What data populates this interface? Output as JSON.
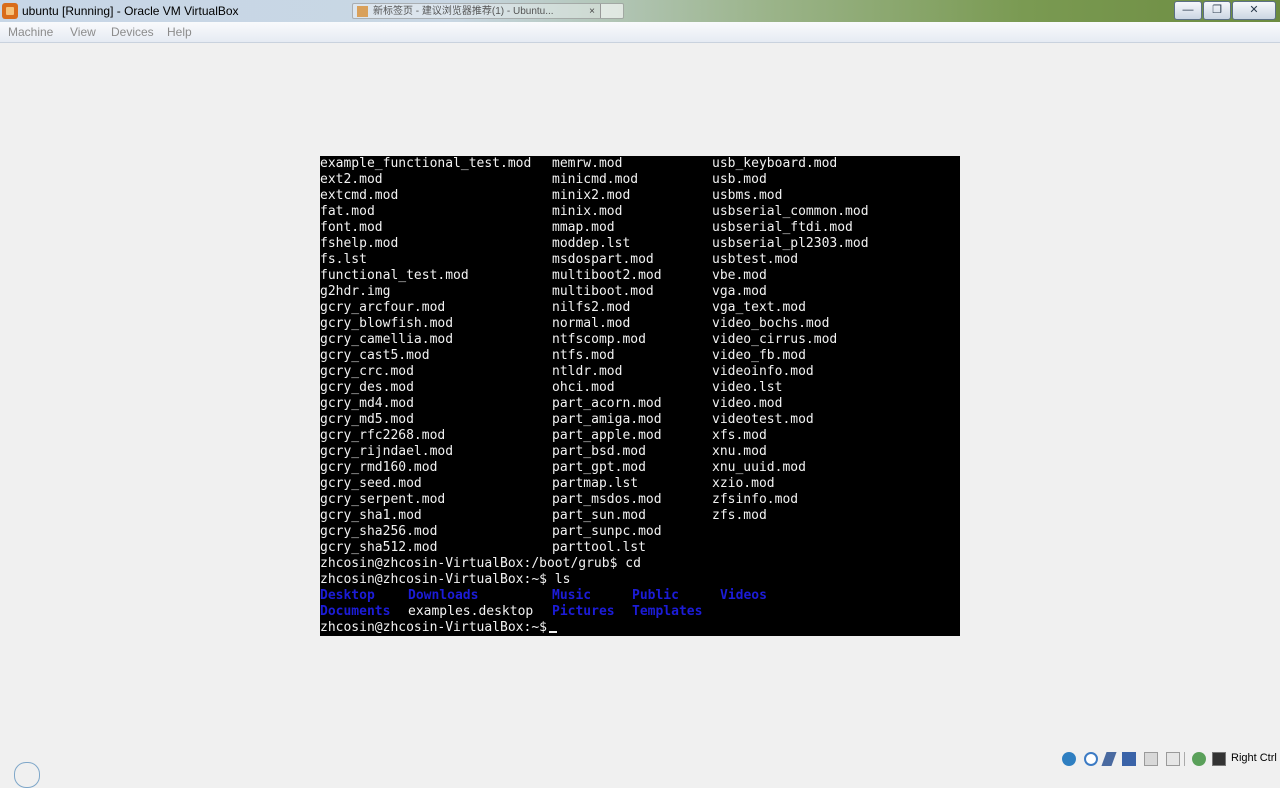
{
  "window": {
    "title": "ubuntu [Running] - Oracle VM VirtualBox",
    "background_tab": "新标签页 - 建议浏览器推荐(1) - Ubuntu...",
    "buttons": {
      "minimize": "—",
      "maximize": "❐",
      "close": "✕"
    }
  },
  "menu": [
    "Machine",
    "View",
    "Devices",
    "Help"
  ],
  "terminal": {
    "file_rows": [
      [
        "example_functional_test.mod",
        "memrw.mod",
        "usb_keyboard.mod"
      ],
      [
        "ext2.mod",
        "minicmd.mod",
        "usb.mod"
      ],
      [
        "extcmd.mod",
        "minix2.mod",
        "usbms.mod"
      ],
      [
        "fat.mod",
        "minix.mod",
        "usbserial_common.mod"
      ],
      [
        "font.mod",
        "mmap.mod",
        "usbserial_ftdi.mod"
      ],
      [
        "fshelp.mod",
        "moddep.lst",
        "usbserial_pl2303.mod"
      ],
      [
        "fs.lst",
        "msdospart.mod",
        "usbtest.mod"
      ],
      [
        "functional_test.mod",
        "multiboot2.mod",
        "vbe.mod"
      ],
      [
        "g2hdr.img",
        "multiboot.mod",
        "vga.mod"
      ],
      [
        "gcry_arcfour.mod",
        "nilfs2.mod",
        "vga_text.mod"
      ],
      [
        "gcry_blowfish.mod",
        "normal.mod",
        "video_bochs.mod"
      ],
      [
        "gcry_camellia.mod",
        "ntfscomp.mod",
        "video_cirrus.mod"
      ],
      [
        "gcry_cast5.mod",
        "ntfs.mod",
        "video_fb.mod"
      ],
      [
        "gcry_crc.mod",
        "ntldr.mod",
        "videoinfo.mod"
      ],
      [
        "gcry_des.mod",
        "ohci.mod",
        "video.lst"
      ],
      [
        "gcry_md4.mod",
        "part_acorn.mod",
        "video.mod"
      ],
      [
        "gcry_md5.mod",
        "part_amiga.mod",
        "videotest.mod"
      ],
      [
        "gcry_rfc2268.mod",
        "part_apple.mod",
        "xfs.mod"
      ],
      [
        "gcry_rijndael.mod",
        "part_bsd.mod",
        "xnu.mod"
      ],
      [
        "gcry_rmd160.mod",
        "part_gpt.mod",
        "xnu_uuid.mod"
      ],
      [
        "gcry_seed.mod",
        "partmap.lst",
        "xzio.mod"
      ],
      [
        "gcry_serpent.mod",
        "part_msdos.mod",
        "zfsinfo.mod"
      ],
      [
        "gcry_sha1.mod",
        "part_sun.mod",
        "zfs.mod"
      ],
      [
        "gcry_sha256.mod",
        "part_sunpc.mod",
        ""
      ],
      [
        "gcry_sha512.mod",
        "parttool.lst",
        ""
      ]
    ],
    "cmd1": "zhcosin@zhcosin-VirtualBox:/boot/grub$ cd",
    "cmd2": "zhcosin@zhcosin-VirtualBox:~$ ls",
    "home_row1": [
      {
        "name": "Desktop",
        "col": 0,
        "dir": true
      },
      {
        "name": "Downloads",
        "col": 11,
        "dir": true
      },
      {
        "name": "Music",
        "col": 29,
        "dir": true
      },
      {
        "name": "Public",
        "col": 39,
        "dir": true
      },
      {
        "name": "Videos",
        "col": 50,
        "dir": true
      }
    ],
    "home_row2": [
      {
        "name": "Documents",
        "col": 0,
        "dir": true
      },
      {
        "name": "examples.desktop",
        "col": 11,
        "dir": false
      },
      {
        "name": "Pictures",
        "col": 29,
        "dir": true
      },
      {
        "name": "Templates",
        "col": 39,
        "dir": true
      }
    ],
    "prompt": "zhcosin@zhcosin-VirtualBox:~$",
    "colors": {
      "foreground": "#f2f2f2",
      "background": "#000000",
      "directory": "#1c1cd8"
    }
  },
  "statusbar": {
    "icons": [
      "hard-disk-icon",
      "optical-drive-icon",
      "usb-icon",
      "network-icon",
      "shared-folder-icon",
      "video-capture-icon",
      "virtualization-icon",
      "mouse-integration-icon"
    ],
    "host_key": "Right Ctrl"
  }
}
